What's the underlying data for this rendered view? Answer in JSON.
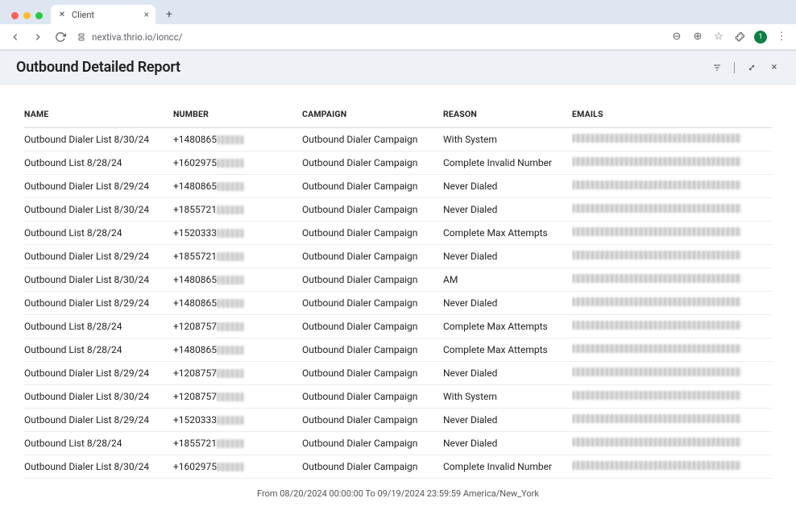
{
  "browser": {
    "tab_title": "Client",
    "url": "nextiva.thrio.io/ioncc/",
    "avatar_initial": "1"
  },
  "header": {
    "title": "Outbound Detailed Report"
  },
  "table": {
    "columns": {
      "name": "NAME",
      "number": "NUMBER",
      "campaign": "CAMPAIGN",
      "reason": "REASON",
      "emails": "EMAILS"
    },
    "rows": [
      {
        "name": "Outbound Dialer List 8/30/24",
        "number_visible": "+1480865",
        "campaign": "Outbound Dialer Campaign",
        "reason": "With System"
      },
      {
        "name": "Outbound List 8/28/24",
        "number_visible": "+1602975",
        "campaign": "Outbound Dialer Campaign",
        "reason": "Complete Invalid Number"
      },
      {
        "name": "Outbound Dialer List 8/29/24",
        "number_visible": "+1480865",
        "campaign": "Outbound Dialer Campaign",
        "reason": "Never Dialed"
      },
      {
        "name": "Outbound Dialer List 8/30/24",
        "number_visible": "+1855721",
        "campaign": "Outbound Dialer Campaign",
        "reason": "Never Dialed"
      },
      {
        "name": "Outbound List 8/28/24",
        "number_visible": "+1520333",
        "campaign": "Outbound Dialer Campaign",
        "reason": "Complete Max Attempts"
      },
      {
        "name": "Outbound Dialer List 8/29/24",
        "number_visible": "+1855721",
        "campaign": "Outbound Dialer Campaign",
        "reason": "Never Dialed"
      },
      {
        "name": "Outbound Dialer List 8/30/24",
        "number_visible": "+1480865",
        "campaign": "Outbound Dialer Campaign",
        "reason": "AM"
      },
      {
        "name": "Outbound Dialer List 8/29/24",
        "number_visible": "+1480865",
        "campaign": "Outbound Dialer Campaign",
        "reason": "Never Dialed"
      },
      {
        "name": "Outbound List 8/28/24",
        "number_visible": "+1208757",
        "campaign": "Outbound Dialer Campaign",
        "reason": "Complete Max Attempts"
      },
      {
        "name": "Outbound List 8/28/24",
        "number_visible": "+1480865",
        "campaign": "Outbound Dialer Campaign",
        "reason": "Complete Max Attempts"
      },
      {
        "name": "Outbound Dialer List 8/29/24",
        "number_visible": "+1208757",
        "campaign": "Outbound Dialer Campaign",
        "reason": "Never Dialed"
      },
      {
        "name": "Outbound Dialer List 8/30/24",
        "number_visible": "+1208757",
        "campaign": "Outbound Dialer Campaign",
        "reason": "With System"
      },
      {
        "name": "Outbound Dialer List 8/29/24",
        "number_visible": "+1520333",
        "campaign": "Outbound Dialer Campaign",
        "reason": "Never Dialed"
      },
      {
        "name": "Outbound List 8/28/24",
        "number_visible": "+1855721",
        "campaign": "Outbound Dialer Campaign",
        "reason": "Never Dialed"
      },
      {
        "name": "Outbound Dialer List 8/30/24",
        "number_visible": "+1602975",
        "campaign": "Outbound Dialer Campaign",
        "reason": "Complete Invalid Number"
      }
    ]
  },
  "footer": {
    "text": "From 08/20/2024 00:00:00 To 09/19/2024 23:59:59 America/New_York"
  }
}
